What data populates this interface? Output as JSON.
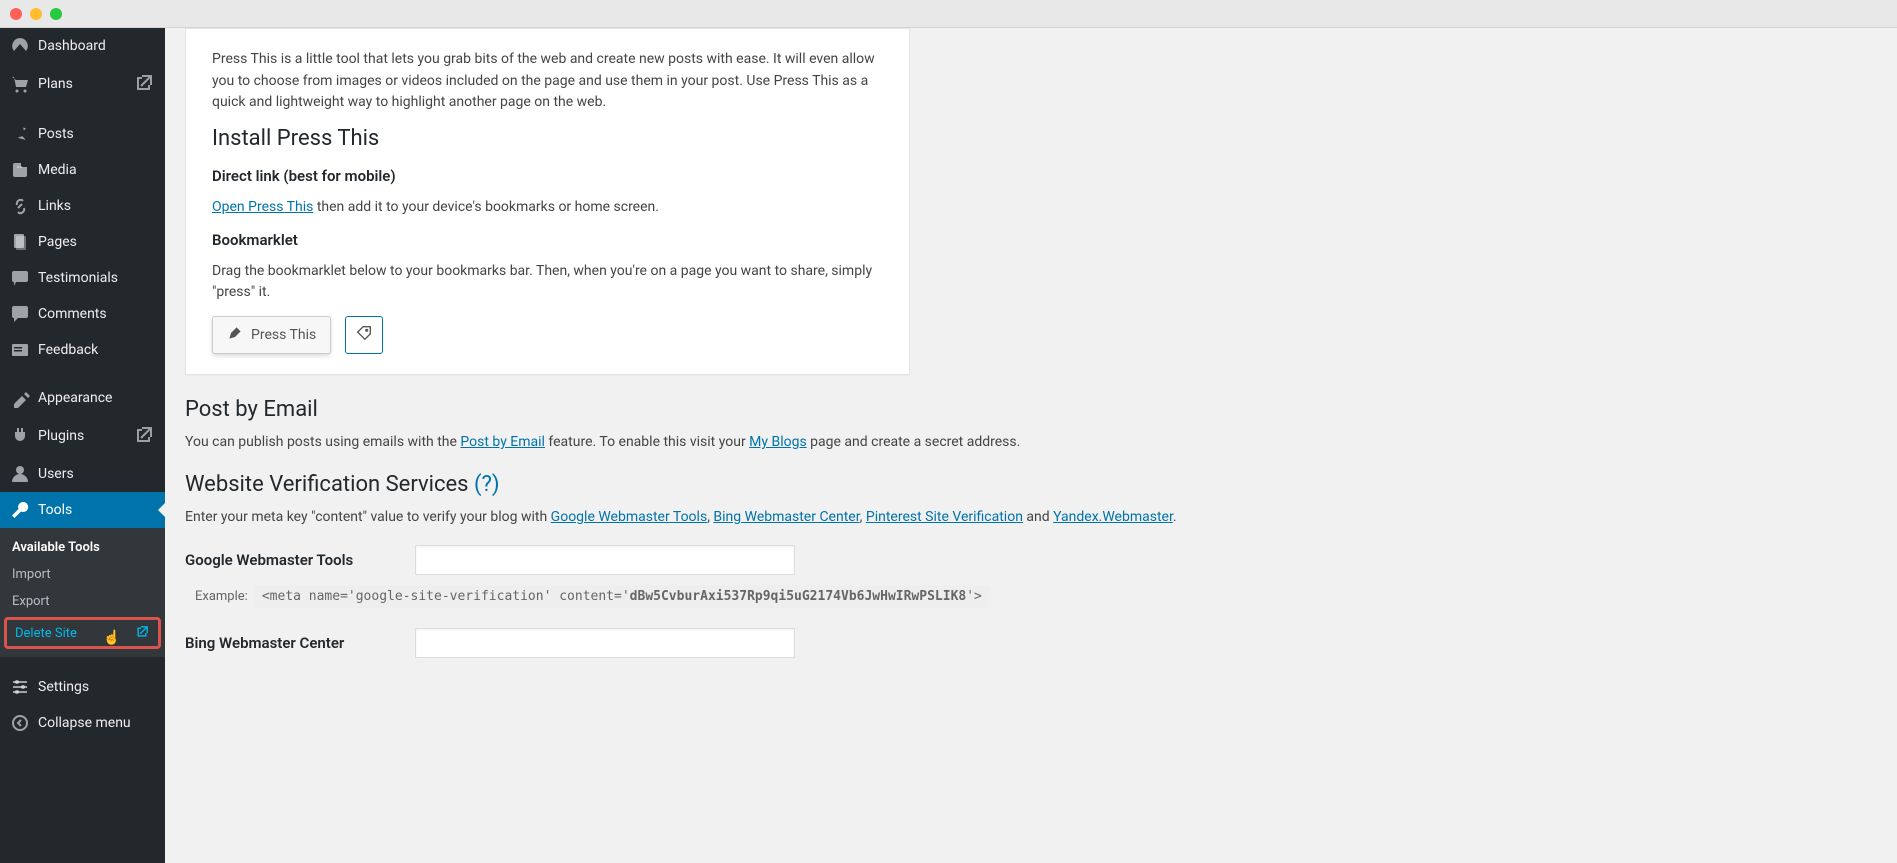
{
  "sidebar": {
    "items": [
      {
        "label": "Dashboard",
        "icon": "dashboard"
      },
      {
        "label": "Plans",
        "icon": "cart",
        "ext": true
      },
      {
        "label": "Posts",
        "icon": "pin",
        "group": true
      },
      {
        "label": "Media",
        "icon": "media"
      },
      {
        "label": "Links",
        "icon": "link"
      },
      {
        "label": "Pages",
        "icon": "pages"
      },
      {
        "label": "Testimonials",
        "icon": "testimonial"
      },
      {
        "label": "Comments",
        "icon": "comment"
      },
      {
        "label": "Feedback",
        "icon": "feedback"
      },
      {
        "label": "Appearance",
        "icon": "appearance",
        "group": true
      },
      {
        "label": "Plugins",
        "icon": "plugin",
        "ext": true
      },
      {
        "label": "Users",
        "icon": "users"
      },
      {
        "label": "Tools",
        "icon": "tools",
        "active": true
      },
      {
        "label": "Settings",
        "icon": "settings",
        "group": true
      },
      {
        "label": "Collapse menu",
        "icon": "collapse"
      }
    ],
    "submenu": [
      {
        "label": "Available Tools",
        "current": true
      },
      {
        "label": "Import"
      },
      {
        "label": "Export"
      },
      {
        "label": "Delete Site",
        "highlight": true,
        "ext": true
      }
    ]
  },
  "press_this": {
    "intro": "Press This is a little tool that lets you grab bits of the web and create new posts with ease. It will even allow you to choose from images or videos included on the page and use them in your post. Use Press This as a quick and lightweight way to highlight another page on the web.",
    "install_heading": "Install Press This",
    "direct_heading": "Direct link (best for mobile)",
    "open_link": "Open Press This",
    "direct_after": " then add it to your device's bookmarks or home screen.",
    "bookmarklet_heading": "Bookmarklet",
    "bookmarklet_text": "Drag the bookmarklet below to your bookmarks bar. Then, when you're on a page you want to share, simply \"press\" it.",
    "button_label": "Press This"
  },
  "post_email": {
    "heading": "Post by Email",
    "before": "You can publish posts using emails with the ",
    "link": "Post by Email",
    "mid": " feature. To enable this visit your ",
    "link2": "My Blogs",
    "after": " page and create a secret address."
  },
  "verification": {
    "heading": "Website Verification Services ",
    "help": "(?)",
    "intro_before": "Enter your meta key \"content\" value to verify your blog with ",
    "links": [
      "Google Webmaster Tools",
      "Bing Webmaster Center",
      "Pinterest Site Verification",
      "Yandex.Webmaster"
    ],
    "intro_joiners": [
      ", ",
      ", ",
      " and "
    ],
    "intro_after": ".",
    "google_label": "Google Webmaster Tools",
    "example_label": "Example:",
    "example_prefix": "<meta name='google-site-verification' content='",
    "example_bold": "dBw5CvburAxi537Rp9qi5uG2174Vb6JwHwIRwPSLIK8",
    "example_suffix": "'>",
    "bing_label": "Bing Webmaster Center"
  }
}
